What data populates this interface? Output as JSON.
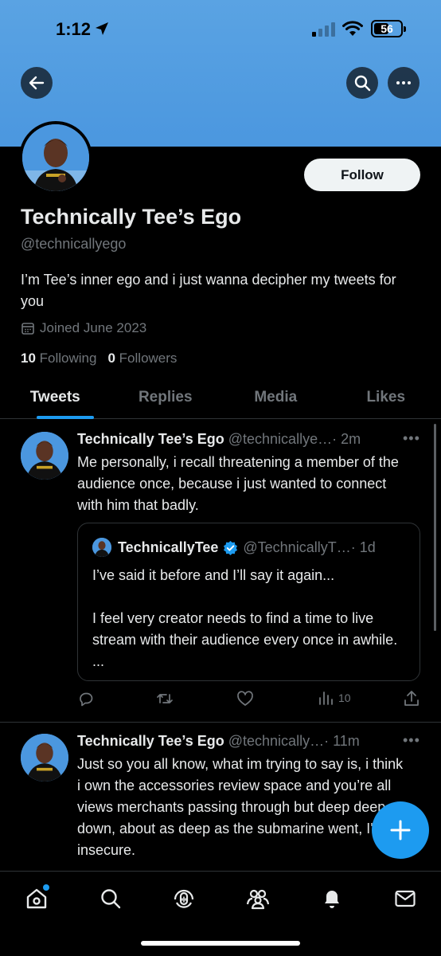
{
  "status_bar": {
    "time": "1:12",
    "battery": "56",
    "battery_level": 0.56
  },
  "profile": {
    "display_name": "Technically Tee’s Ego",
    "handle": "@technicallyego",
    "bio": "I’m Tee’s inner ego and i just wanna decipher my tweets for you",
    "joined": "Joined June 2023",
    "following_count": "10",
    "following_label": "Following",
    "followers_count": "0",
    "followers_label": "Followers",
    "follow_label": "Follow"
  },
  "tabs": [
    {
      "label": "Tweets",
      "active": true
    },
    {
      "label": "Replies",
      "active": false
    },
    {
      "label": "Media",
      "active": false
    },
    {
      "label": "Likes",
      "active": false
    }
  ],
  "tweets": [
    {
      "name": "Technically Tee’s Ego",
      "handle": "@technicallye…",
      "time": "· 2m",
      "text": "Me personally, i recall threatening a member of the audience once, because i just wanted to connect with him that badly.",
      "quote": {
        "name": "TechnicallyTee",
        "verified": true,
        "handle": "@TechnicallyT…",
        "time": "· 1d",
        "text_line1": "I’ve said it before and I’ll say it again...",
        "text_line2": "I feel very creator needs to find a time to live stream with their audience every once in awhile.   ..."
      },
      "views": "10"
    },
    {
      "name": "Technically Tee’s Ego",
      "handle": "@technically…",
      "time": "· 11m",
      "text": "Just so you all know, what im trying to say is, i think i own the accessories review space and you’re all views merchants passing through but deep deep down, about as deep as the submarine went, I'm insecure."
    }
  ],
  "colors": {
    "accent": "#1d9bf0",
    "banner": "#4b97df",
    "text": "#e7e9ea",
    "muted": "#71767b"
  },
  "icons": {
    "back": "arrow-left-icon",
    "search": "search-icon",
    "more": "more-horizontal-icon",
    "calendar": "calendar-icon",
    "reply": "reply-icon",
    "retweet": "retweet-icon",
    "like": "heart-icon",
    "views": "views-icon",
    "share": "share-icon",
    "compose": "plus-icon",
    "nav": [
      "home-icon",
      "search-icon",
      "spaces-icon",
      "communities-icon",
      "notifications-icon",
      "messages-icon"
    ]
  }
}
